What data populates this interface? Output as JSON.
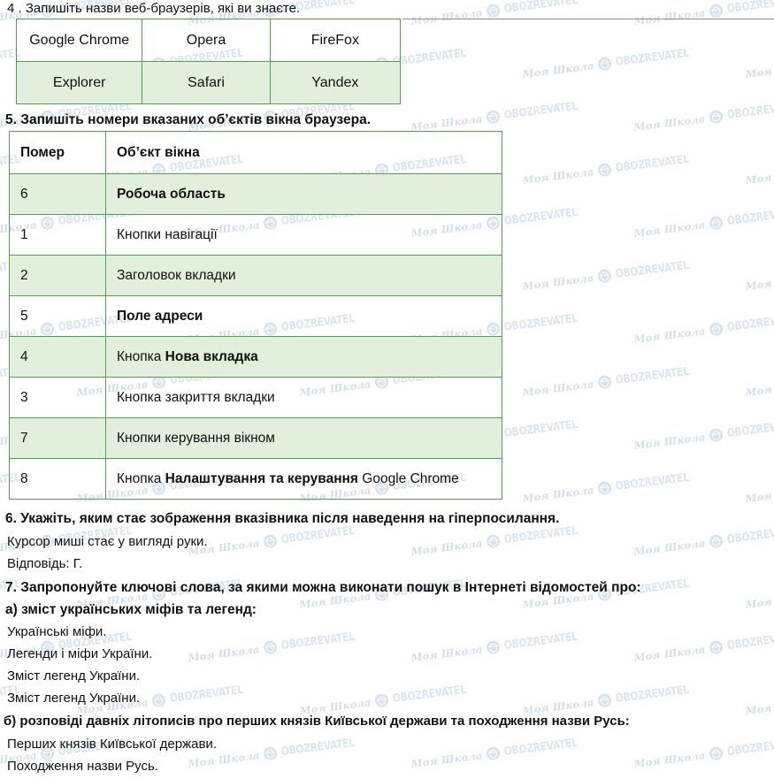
{
  "watermark": {
    "school_text": "Моя Школа",
    "brand_text": "OBOZREVATEL",
    "icon": "globe-icon",
    "color": "#c6d6e6"
  },
  "theme": {
    "table_border": "#4fa14f",
    "row_shade": "#e2efdc",
    "text": "#111111",
    "rule": "#8f8f8f"
  },
  "questions": {
    "q4": {
      "number": "4 .",
      "text": "4 . Запишіть назви веб-браузерів, які ви знаєте."
    },
    "q5": {
      "text": "5. Запишіть номери вказаних об’єктів вікна браузера."
    },
    "q6": {
      "text": "6. Укажіть, яким стає зображення вказівника після наведення на гіперпосилання.",
      "answer_line1": "Курсор миші стає у вигляді руки.",
      "answer_line2": "Відповідь: Г."
    },
    "q7": {
      "text": "7. Запропонуйте ключові слова, за якими можна виконати пошук в Інтернеті відомостей про:",
      "part_a": {
        "text": "а) зміст українських міфів та легенд:",
        "answers": [
          "Українські міфи.",
          "Легенди і міфи України.",
          "Зміст легенд України.",
          "Зміст легенд України."
        ]
      },
      "part_b": {
        "text": "б) розповіді давніх літописів про перших князів Київської держави та походження назви Русь:",
        "answers": [
          "Перших князів Київської держави.",
          "Походження назви Русь."
        ]
      }
    }
  },
  "browsers_table": {
    "rows": [
      [
        "Google Chrome",
        "Opera",
        "FireFox"
      ],
      [
        "Explorer",
        "Safari",
        "Yandex"
      ]
    ]
  },
  "objects_table": {
    "headers": [
      "Помер",
      "Об’єкт вікна"
    ],
    "rows": [
      {
        "num": "6",
        "pre": "",
        "bold": "Робоча область",
        "post": ""
      },
      {
        "num": "1",
        "pre": "Кнопки навігації",
        "bold": "",
        "post": ""
      },
      {
        "num": "2",
        "pre": "Заголовок вкладки",
        "bold": "",
        "post": ""
      },
      {
        "num": "5",
        "pre": "",
        "bold": "Поле адреси",
        "post": ""
      },
      {
        "num": "4",
        "pre": "Кнопка ",
        "bold": "Нова вкладка",
        "post": ""
      },
      {
        "num": "3",
        "pre": "Кнопка закриття вкладки",
        "bold": "",
        "post": ""
      },
      {
        "num": "7",
        "pre": "Кнопки керування вікном",
        "bold": "",
        "post": ""
      },
      {
        "num": "8",
        "pre": "Кнопка ",
        "bold": "Налаштування та керування",
        "post": " Google Chrome"
      }
    ]
  }
}
